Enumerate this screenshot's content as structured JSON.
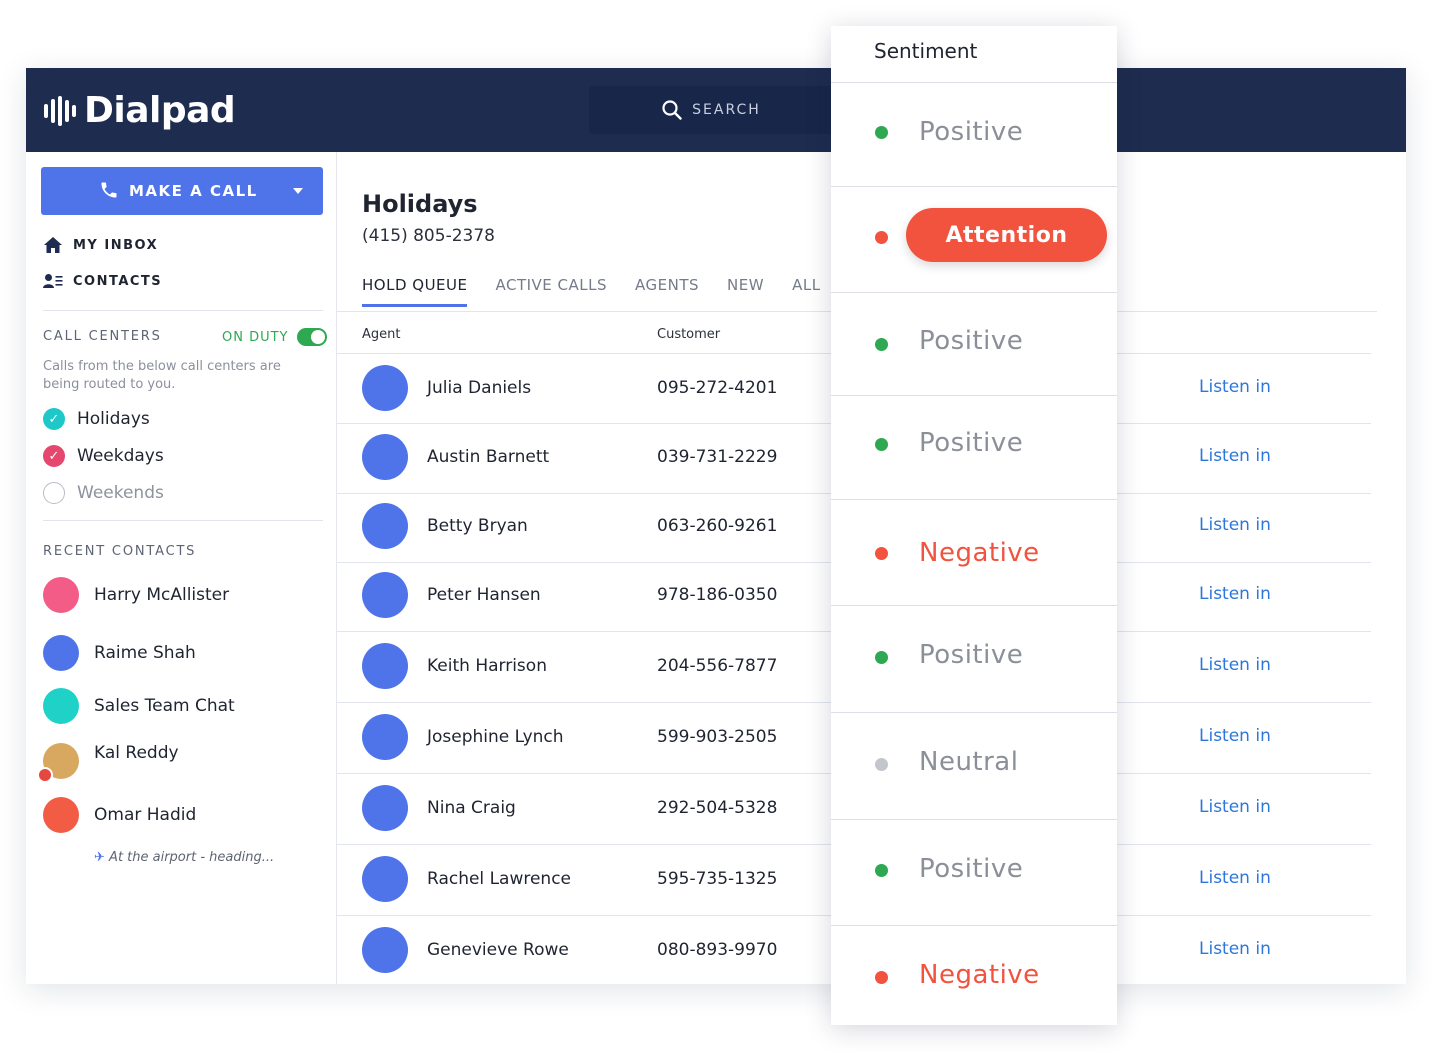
{
  "brand": {
    "name": "Dialpad"
  },
  "search": {
    "label": "SEARCH"
  },
  "sidebar": {
    "make_call": "MAKE A CALL",
    "nav": [
      {
        "label": "MY INBOX",
        "icon": "home-icon"
      },
      {
        "label": "CONTACTS",
        "icon": "contacts-icon"
      }
    ],
    "call_centers": {
      "title": "CALL CENTERS",
      "on_duty": "ON DUTY",
      "description": "Calls from the below call centers are being routed to you.",
      "items": [
        {
          "label": "Holidays",
          "checked": true,
          "color": "#1ec8c8"
        },
        {
          "label": "Weekdays",
          "checked": true,
          "color": "#e5486e"
        },
        {
          "label": "Weekends",
          "checked": false,
          "color": "#b9bdc7"
        }
      ]
    },
    "recent_contacts": {
      "title": "RECENT CONTACTS",
      "items": [
        {
          "name": "Harry McAllister",
          "color": "#f25c86"
        },
        {
          "name": "Raime Shah",
          "color": "#4f74ea"
        },
        {
          "name": "Sales Team Chat",
          "color": "#1fd2c8"
        },
        {
          "name": "Kal Reddy",
          "color": "#d9a860",
          "status": "At the airport - heading..."
        },
        {
          "name": "Omar Hadid",
          "color": "#f25c44"
        }
      ]
    }
  },
  "main": {
    "title": "Holidays",
    "phone": "(415) 805-2378",
    "tabs": [
      "HOLD QUEUE",
      "ACTIVE CALLS",
      "AGENTS",
      "NEW",
      "ALL"
    ],
    "columns": {
      "agent": "Agent",
      "customer": "Customer"
    },
    "listen_label": "Listen in",
    "rows": [
      {
        "agent": "Julia Daniels",
        "customer": "095-272-4201"
      },
      {
        "agent": "Austin Barnett",
        "customer": "039-731-2229"
      },
      {
        "agent": "Betty Bryan",
        "customer": "063-260-9261"
      },
      {
        "agent": "Peter Hansen",
        "customer": "978-186-0350"
      },
      {
        "agent": "Keith Harrison",
        "customer": "204-556-7877"
      },
      {
        "agent": "Josephine Lynch",
        "customer": "599-903-2505"
      },
      {
        "agent": "Nina Craig",
        "customer": "292-504-5328"
      },
      {
        "agent": "Rachel Lawrence",
        "customer": "595-735-1325"
      },
      {
        "agent": "Genevieve Rowe",
        "customer": "080-893-9970"
      }
    ]
  },
  "sentiment": {
    "title": "Sentiment",
    "items": [
      {
        "label": "Positive",
        "dot": "#2ea851",
        "text_color": "#8b8f98"
      },
      {
        "label": "Attention",
        "dot": "#f2533e",
        "text_color": "#ffffff"
      },
      {
        "label": "Positive",
        "dot": "#2ea851",
        "text_color": "#8b8f98"
      },
      {
        "label": "Positive",
        "dot": "#2ea851",
        "text_color": "#8b8f98"
      },
      {
        "label": "Negative",
        "dot": "#f2533e",
        "text_color": "#f2533e"
      },
      {
        "label": "Positive",
        "dot": "#2ea851",
        "text_color": "#8b8f98"
      },
      {
        "label": "Neutral",
        "dot": "#c3c6cc",
        "text_color": "#8b8f98"
      },
      {
        "label": "Positive",
        "dot": "#2ea851",
        "text_color": "#8b8f98"
      },
      {
        "label": "Negative",
        "dot": "#f2533e",
        "text_color": "#f2533e"
      }
    ]
  }
}
